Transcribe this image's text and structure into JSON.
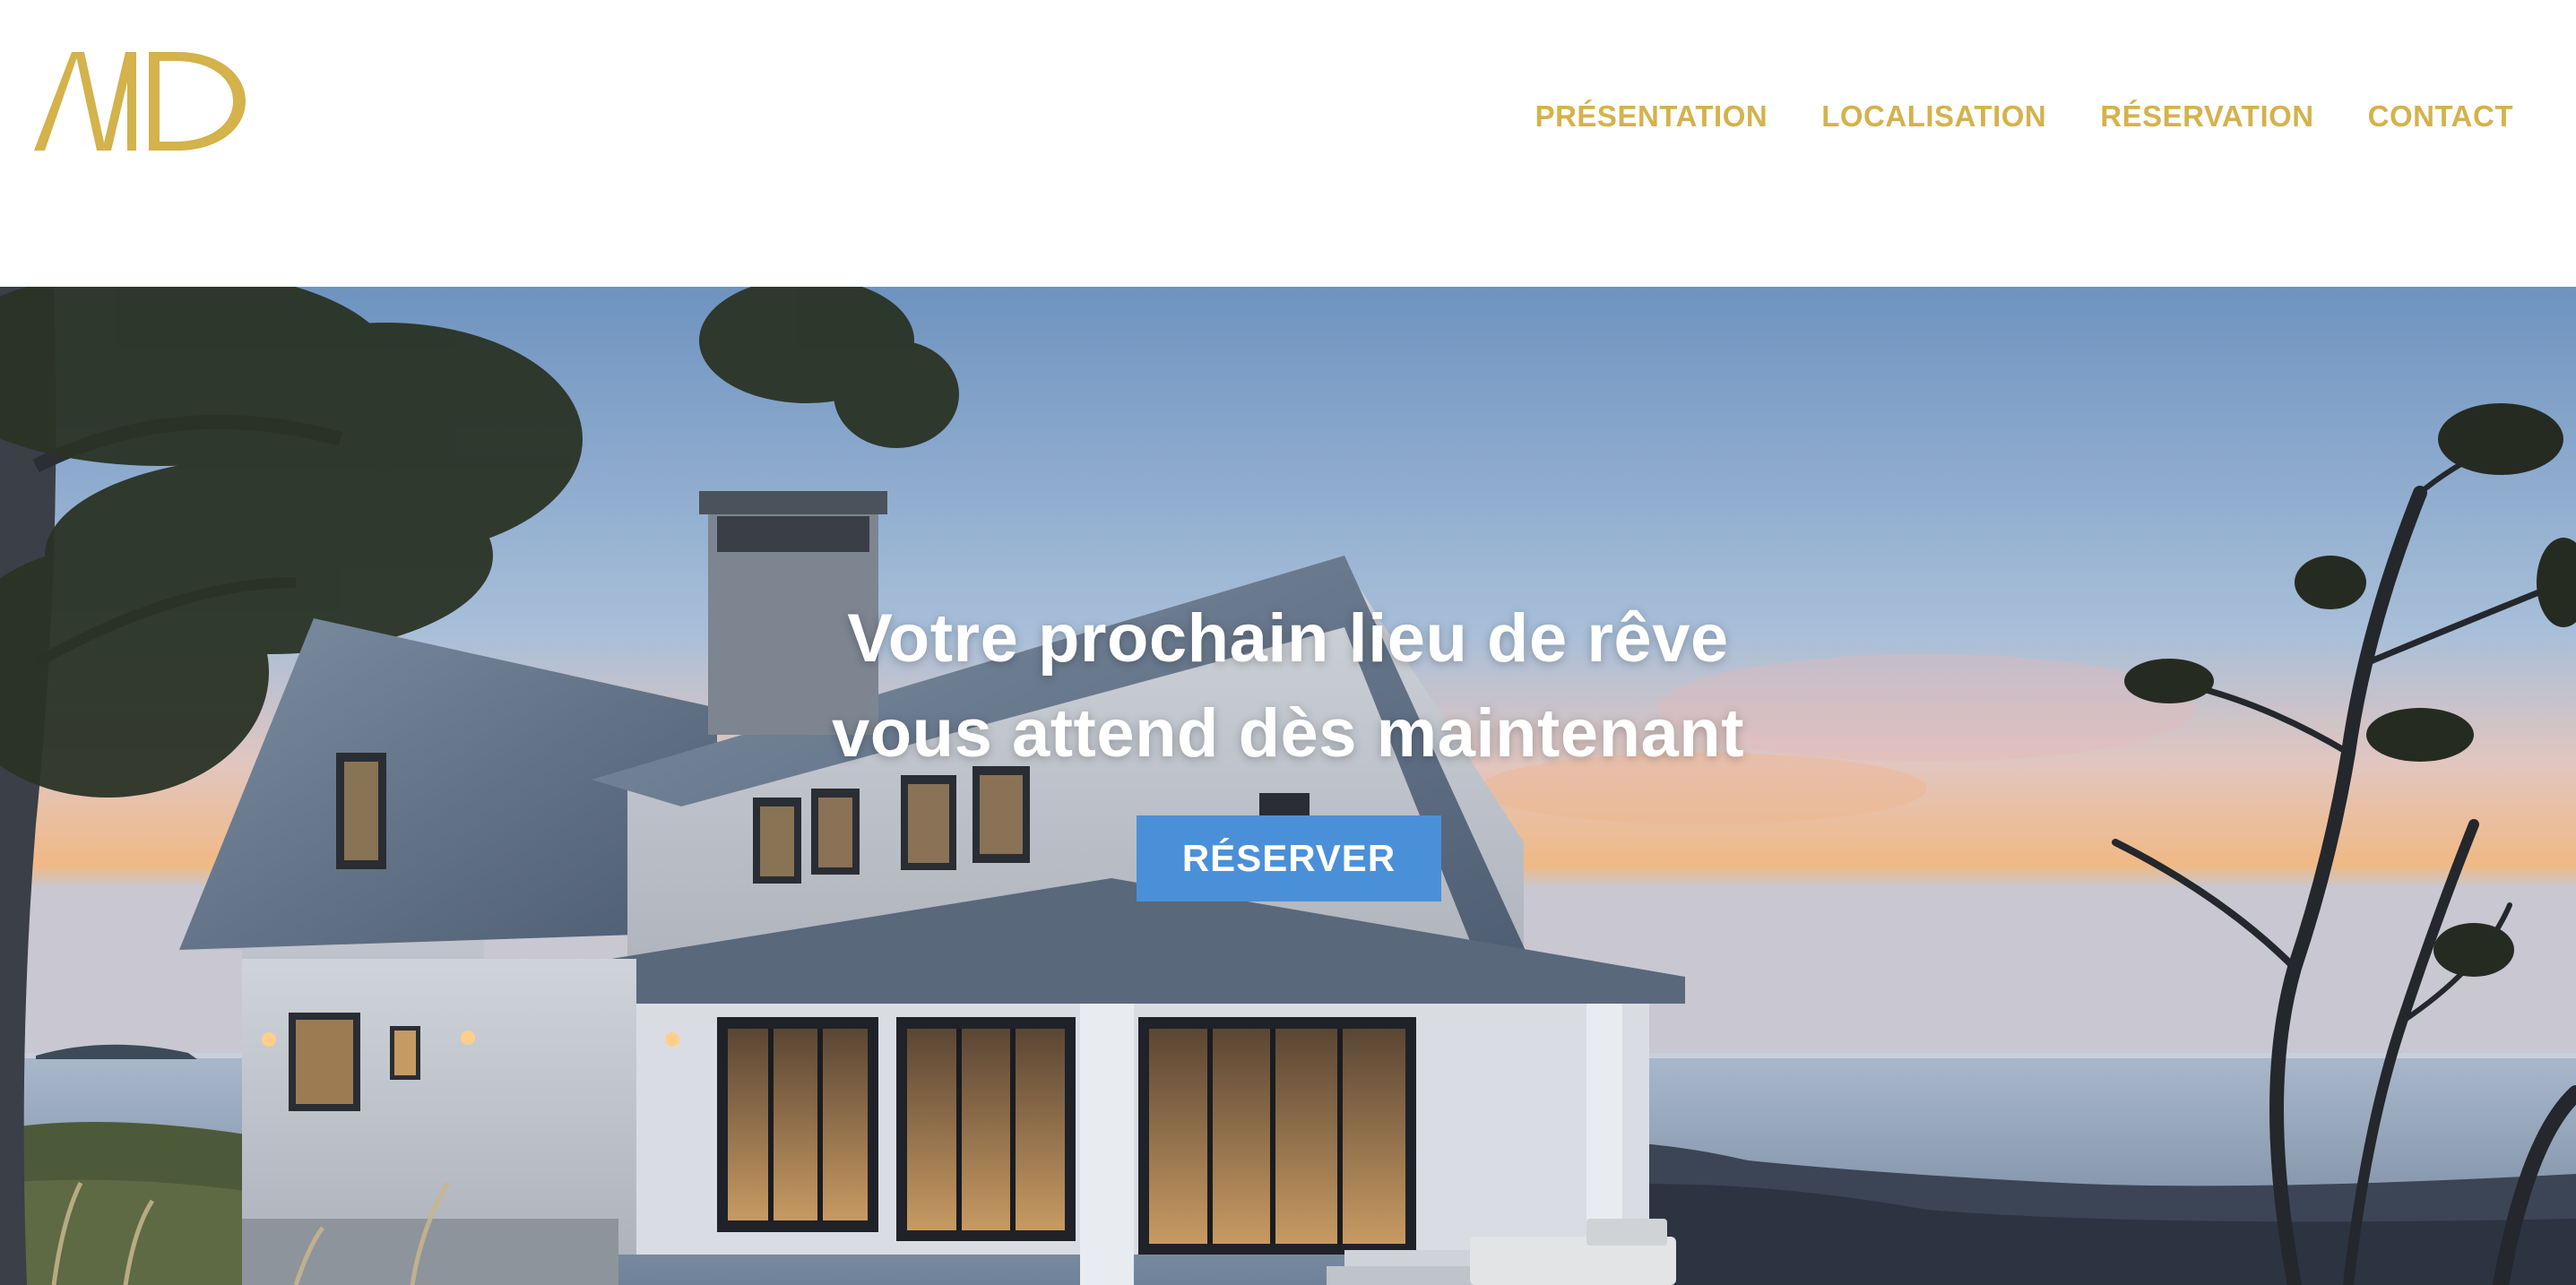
{
  "brand": {
    "logo_text": "MD",
    "accent_color": "#d4b24c"
  },
  "nav": {
    "items": [
      {
        "label": "PRÉSENTATION"
      },
      {
        "label": "LOCALISATION"
      },
      {
        "label": "RÉSERVATION"
      },
      {
        "label": "CONTACT"
      }
    ]
  },
  "hero": {
    "title_line_1": "Votre prochain lieu de rêve",
    "title_line_2": "vous attend dès maintenant",
    "cta_label": "RÉSERVER",
    "cta_color": "#4a90d9",
    "image": "coastal-house-at-sunset"
  }
}
